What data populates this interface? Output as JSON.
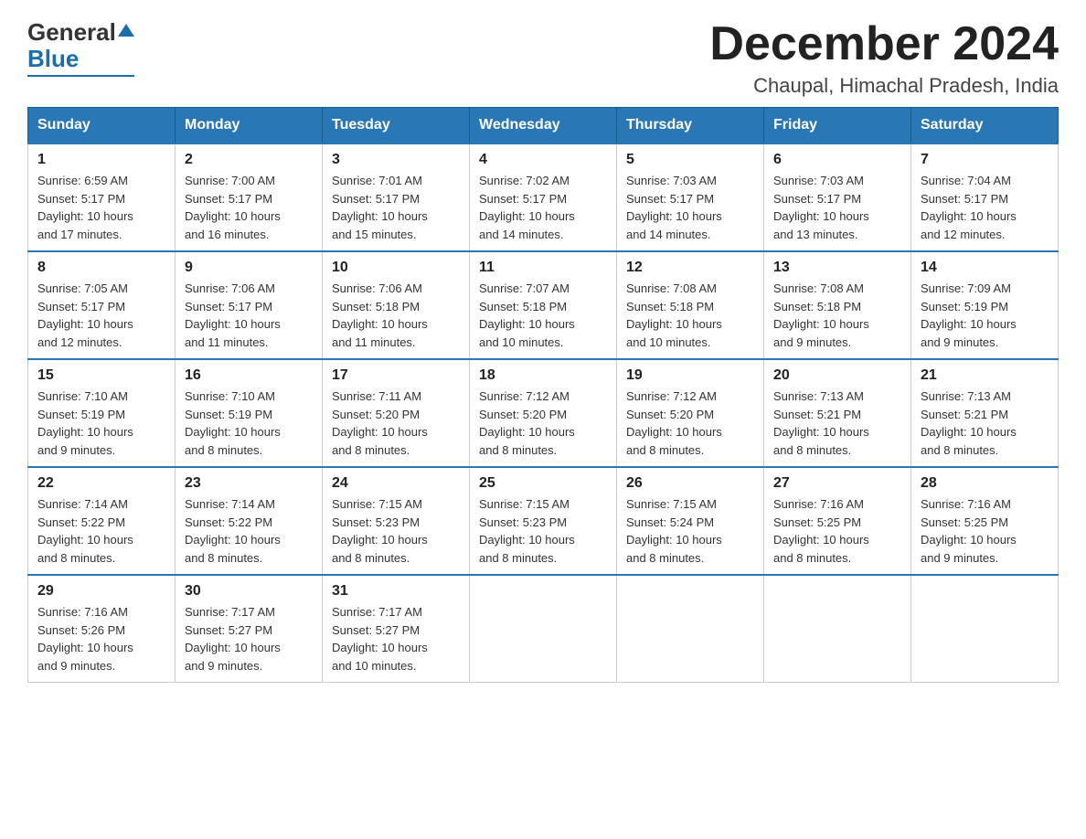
{
  "header": {
    "logo_general": "General",
    "logo_blue": "Blue",
    "month_title": "December 2024",
    "location": "Chaupal, Himachal Pradesh, India"
  },
  "days_of_week": [
    "Sunday",
    "Monday",
    "Tuesday",
    "Wednesday",
    "Thursday",
    "Friday",
    "Saturday"
  ],
  "weeks": [
    [
      {
        "day": "1",
        "sunrise": "6:59 AM",
        "sunset": "5:17 PM",
        "daylight": "10 hours and 17 minutes."
      },
      {
        "day": "2",
        "sunrise": "7:00 AM",
        "sunset": "5:17 PM",
        "daylight": "10 hours and 16 minutes."
      },
      {
        "day": "3",
        "sunrise": "7:01 AM",
        "sunset": "5:17 PM",
        "daylight": "10 hours and 15 minutes."
      },
      {
        "day": "4",
        "sunrise": "7:02 AM",
        "sunset": "5:17 PM",
        "daylight": "10 hours and 14 minutes."
      },
      {
        "day": "5",
        "sunrise": "7:03 AM",
        "sunset": "5:17 PM",
        "daylight": "10 hours and 14 minutes."
      },
      {
        "day": "6",
        "sunrise": "7:03 AM",
        "sunset": "5:17 PM",
        "daylight": "10 hours and 13 minutes."
      },
      {
        "day": "7",
        "sunrise": "7:04 AM",
        "sunset": "5:17 PM",
        "daylight": "10 hours and 12 minutes."
      }
    ],
    [
      {
        "day": "8",
        "sunrise": "7:05 AM",
        "sunset": "5:17 PM",
        "daylight": "10 hours and 12 minutes."
      },
      {
        "day": "9",
        "sunrise": "7:06 AM",
        "sunset": "5:17 PM",
        "daylight": "10 hours and 11 minutes."
      },
      {
        "day": "10",
        "sunrise": "7:06 AM",
        "sunset": "5:18 PM",
        "daylight": "10 hours and 11 minutes."
      },
      {
        "day": "11",
        "sunrise": "7:07 AM",
        "sunset": "5:18 PM",
        "daylight": "10 hours and 10 minutes."
      },
      {
        "day": "12",
        "sunrise": "7:08 AM",
        "sunset": "5:18 PM",
        "daylight": "10 hours and 10 minutes."
      },
      {
        "day": "13",
        "sunrise": "7:08 AM",
        "sunset": "5:18 PM",
        "daylight": "10 hours and 9 minutes."
      },
      {
        "day": "14",
        "sunrise": "7:09 AM",
        "sunset": "5:19 PM",
        "daylight": "10 hours and 9 minutes."
      }
    ],
    [
      {
        "day": "15",
        "sunrise": "7:10 AM",
        "sunset": "5:19 PM",
        "daylight": "10 hours and 9 minutes."
      },
      {
        "day": "16",
        "sunrise": "7:10 AM",
        "sunset": "5:19 PM",
        "daylight": "10 hours and 8 minutes."
      },
      {
        "day": "17",
        "sunrise": "7:11 AM",
        "sunset": "5:20 PM",
        "daylight": "10 hours and 8 minutes."
      },
      {
        "day": "18",
        "sunrise": "7:12 AM",
        "sunset": "5:20 PM",
        "daylight": "10 hours and 8 minutes."
      },
      {
        "day": "19",
        "sunrise": "7:12 AM",
        "sunset": "5:20 PM",
        "daylight": "10 hours and 8 minutes."
      },
      {
        "day": "20",
        "sunrise": "7:13 AM",
        "sunset": "5:21 PM",
        "daylight": "10 hours and 8 minutes."
      },
      {
        "day": "21",
        "sunrise": "7:13 AM",
        "sunset": "5:21 PM",
        "daylight": "10 hours and 8 minutes."
      }
    ],
    [
      {
        "day": "22",
        "sunrise": "7:14 AM",
        "sunset": "5:22 PM",
        "daylight": "10 hours and 8 minutes."
      },
      {
        "day": "23",
        "sunrise": "7:14 AM",
        "sunset": "5:22 PM",
        "daylight": "10 hours and 8 minutes."
      },
      {
        "day": "24",
        "sunrise": "7:15 AM",
        "sunset": "5:23 PM",
        "daylight": "10 hours and 8 minutes."
      },
      {
        "day": "25",
        "sunrise": "7:15 AM",
        "sunset": "5:23 PM",
        "daylight": "10 hours and 8 minutes."
      },
      {
        "day": "26",
        "sunrise": "7:15 AM",
        "sunset": "5:24 PM",
        "daylight": "10 hours and 8 minutes."
      },
      {
        "day": "27",
        "sunrise": "7:16 AM",
        "sunset": "5:25 PM",
        "daylight": "10 hours and 8 minutes."
      },
      {
        "day": "28",
        "sunrise": "7:16 AM",
        "sunset": "5:25 PM",
        "daylight": "10 hours and 9 minutes."
      }
    ],
    [
      {
        "day": "29",
        "sunrise": "7:16 AM",
        "sunset": "5:26 PM",
        "daylight": "10 hours and 9 minutes."
      },
      {
        "day": "30",
        "sunrise": "7:17 AM",
        "sunset": "5:27 PM",
        "daylight": "10 hours and 9 minutes."
      },
      {
        "day": "31",
        "sunrise": "7:17 AM",
        "sunset": "5:27 PM",
        "daylight": "10 hours and 10 minutes."
      },
      null,
      null,
      null,
      null
    ]
  ],
  "labels": {
    "sunrise": "Sunrise:",
    "sunset": "Sunset:",
    "daylight": "Daylight:"
  }
}
